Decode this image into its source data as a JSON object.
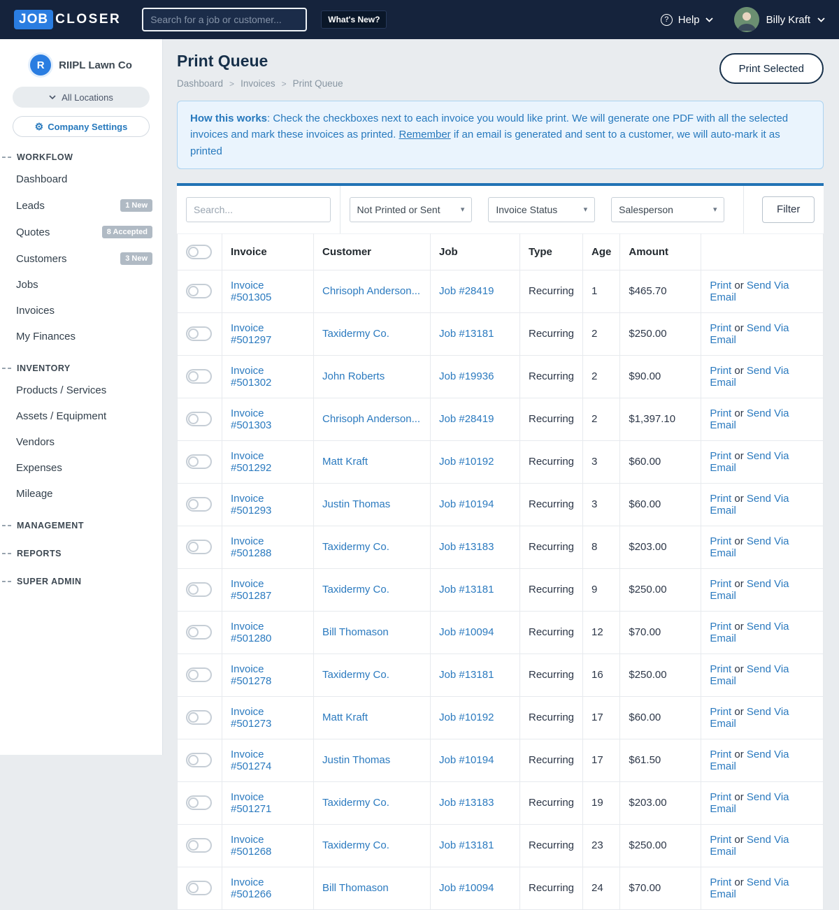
{
  "colors": {
    "header_navy": "#15233c",
    "brand_blue": "#2a7de1",
    "card_accent_blue": "#2273b5",
    "link_blue": "#2b7abf",
    "info_text_blue": "#2779bd",
    "info_bg": "#eaf4fd"
  },
  "header": {
    "logo_job": "JOB",
    "logo_closer": "CLOSER",
    "search_placeholder": "Search for a job or customer...",
    "whats_new": "What's New?",
    "help": "Help",
    "help_icon": "?",
    "user": "Billy Kraft"
  },
  "sidebar": {
    "company_initial": "R",
    "company": "RIIPL Lawn Co",
    "locations": "All Locations",
    "company_settings": "Company Settings",
    "settings_icon": "⚙",
    "sections": [
      {
        "label": "WORKFLOW",
        "items": [
          {
            "label": "Dashboard"
          },
          {
            "label": "Leads",
            "badge": "1 New"
          },
          {
            "label": "Quotes",
            "badge": "8 Accepted"
          },
          {
            "label": "Customers",
            "badge": "3 New"
          },
          {
            "label": "Jobs"
          },
          {
            "label": "Invoices"
          },
          {
            "label": "My Finances"
          }
        ]
      },
      {
        "label": "INVENTORY",
        "items": [
          {
            "label": "Products / Services"
          },
          {
            "label": "Assets / Equipment"
          },
          {
            "label": "Vendors"
          },
          {
            "label": "Expenses"
          },
          {
            "label": "Mileage"
          }
        ]
      },
      {
        "label": "MANAGEMENT",
        "items": []
      },
      {
        "label": "REPORTS",
        "items": []
      },
      {
        "label": "SUPER ADMIN",
        "items": []
      }
    ]
  },
  "main": {
    "title": "Print Queue",
    "breadcrumb": [
      "Dashboard",
      "Invoices",
      "Print Queue"
    ],
    "breadcrumb_sep": ">",
    "print_selected": "Print Selected",
    "info": {
      "bold": "How this works",
      "text1": ": Check the checkboxes next to each invoice you would like print. We will generate one PDF with all the selected invoices and mark these invoices as printed. ",
      "underline": "Remember",
      "text2": " if an email is generated and sent to a customer, we will auto-mark it as printed"
    },
    "filters": {
      "search_placeholder": "Search...",
      "selects": [
        "Not Printed or Sent",
        "Invoice Status",
        "Salesperson"
      ],
      "caret": "▾",
      "filter_button": "Filter"
    },
    "table": {
      "headers": [
        "Invoice",
        "Customer",
        "Job",
        "Type",
        "Age",
        "Amount"
      ],
      "action_print": "Print",
      "action_or": "or",
      "action_email": "Send Via Email",
      "rows": [
        {
          "invoice": "Invoice #501305",
          "customer": "Chrisoph Anderson...",
          "job": "Job #28419",
          "type": "Recurring",
          "age": "1",
          "amount": "$465.70"
        },
        {
          "invoice": "Invoice #501297",
          "customer": "Taxidermy Co.",
          "job": "Job #13181",
          "type": "Recurring",
          "age": "2",
          "amount": "$250.00"
        },
        {
          "invoice": "Invoice #501302",
          "customer": "John Roberts",
          "job": "Job #19936",
          "type": "Recurring",
          "age": "2",
          "amount": "$90.00"
        },
        {
          "invoice": "Invoice #501303",
          "customer": "Chrisoph Anderson...",
          "job": "Job #28419",
          "type": "Recurring",
          "age": "2",
          "amount": "$1,397.10"
        },
        {
          "invoice": "Invoice #501292",
          "customer": "Matt Kraft",
          "job": "Job #10192",
          "type": "Recurring",
          "age": "3",
          "amount": "$60.00"
        },
        {
          "invoice": "Invoice #501293",
          "customer": "Justin Thomas",
          "job": "Job #10194",
          "type": "Recurring",
          "age": "3",
          "amount": "$60.00"
        },
        {
          "invoice": "Invoice #501288",
          "customer": "Taxidermy Co.",
          "job": "Job #13183",
          "type": "Recurring",
          "age": "8",
          "amount": "$203.00"
        },
        {
          "invoice": "Invoice #501287",
          "customer": "Taxidermy Co.",
          "job": "Job #13181",
          "type": "Recurring",
          "age": "9",
          "amount": "$250.00"
        },
        {
          "invoice": "Invoice #501280",
          "customer": "Bill Thomason",
          "job": "Job #10094",
          "type": "Recurring",
          "age": "12",
          "amount": "$70.00"
        },
        {
          "invoice": "Invoice #501278",
          "customer": "Taxidermy Co.",
          "job": "Job #13181",
          "type": "Recurring",
          "age": "16",
          "amount": "$250.00"
        },
        {
          "invoice": "Invoice #501273",
          "customer": "Matt Kraft",
          "job": "Job #10192",
          "type": "Recurring",
          "age": "17",
          "amount": "$60.00"
        },
        {
          "invoice": "Invoice #501274",
          "customer": "Justin Thomas",
          "job": "Job #10194",
          "type": "Recurring",
          "age": "17",
          "amount": "$61.50"
        },
        {
          "invoice": "Invoice #501271",
          "customer": "Taxidermy Co.",
          "job": "Job #13183",
          "type": "Recurring",
          "age": "19",
          "amount": "$203.00"
        },
        {
          "invoice": "Invoice #501268",
          "customer": "Taxidermy Co.",
          "job": "Job #13181",
          "type": "Recurring",
          "age": "23",
          "amount": "$250.00"
        },
        {
          "invoice": "Invoice #501266",
          "customer": "Bill Thomason",
          "job": "Job #10094",
          "type": "Recurring",
          "age": "24",
          "amount": "$70.00"
        }
      ]
    }
  }
}
